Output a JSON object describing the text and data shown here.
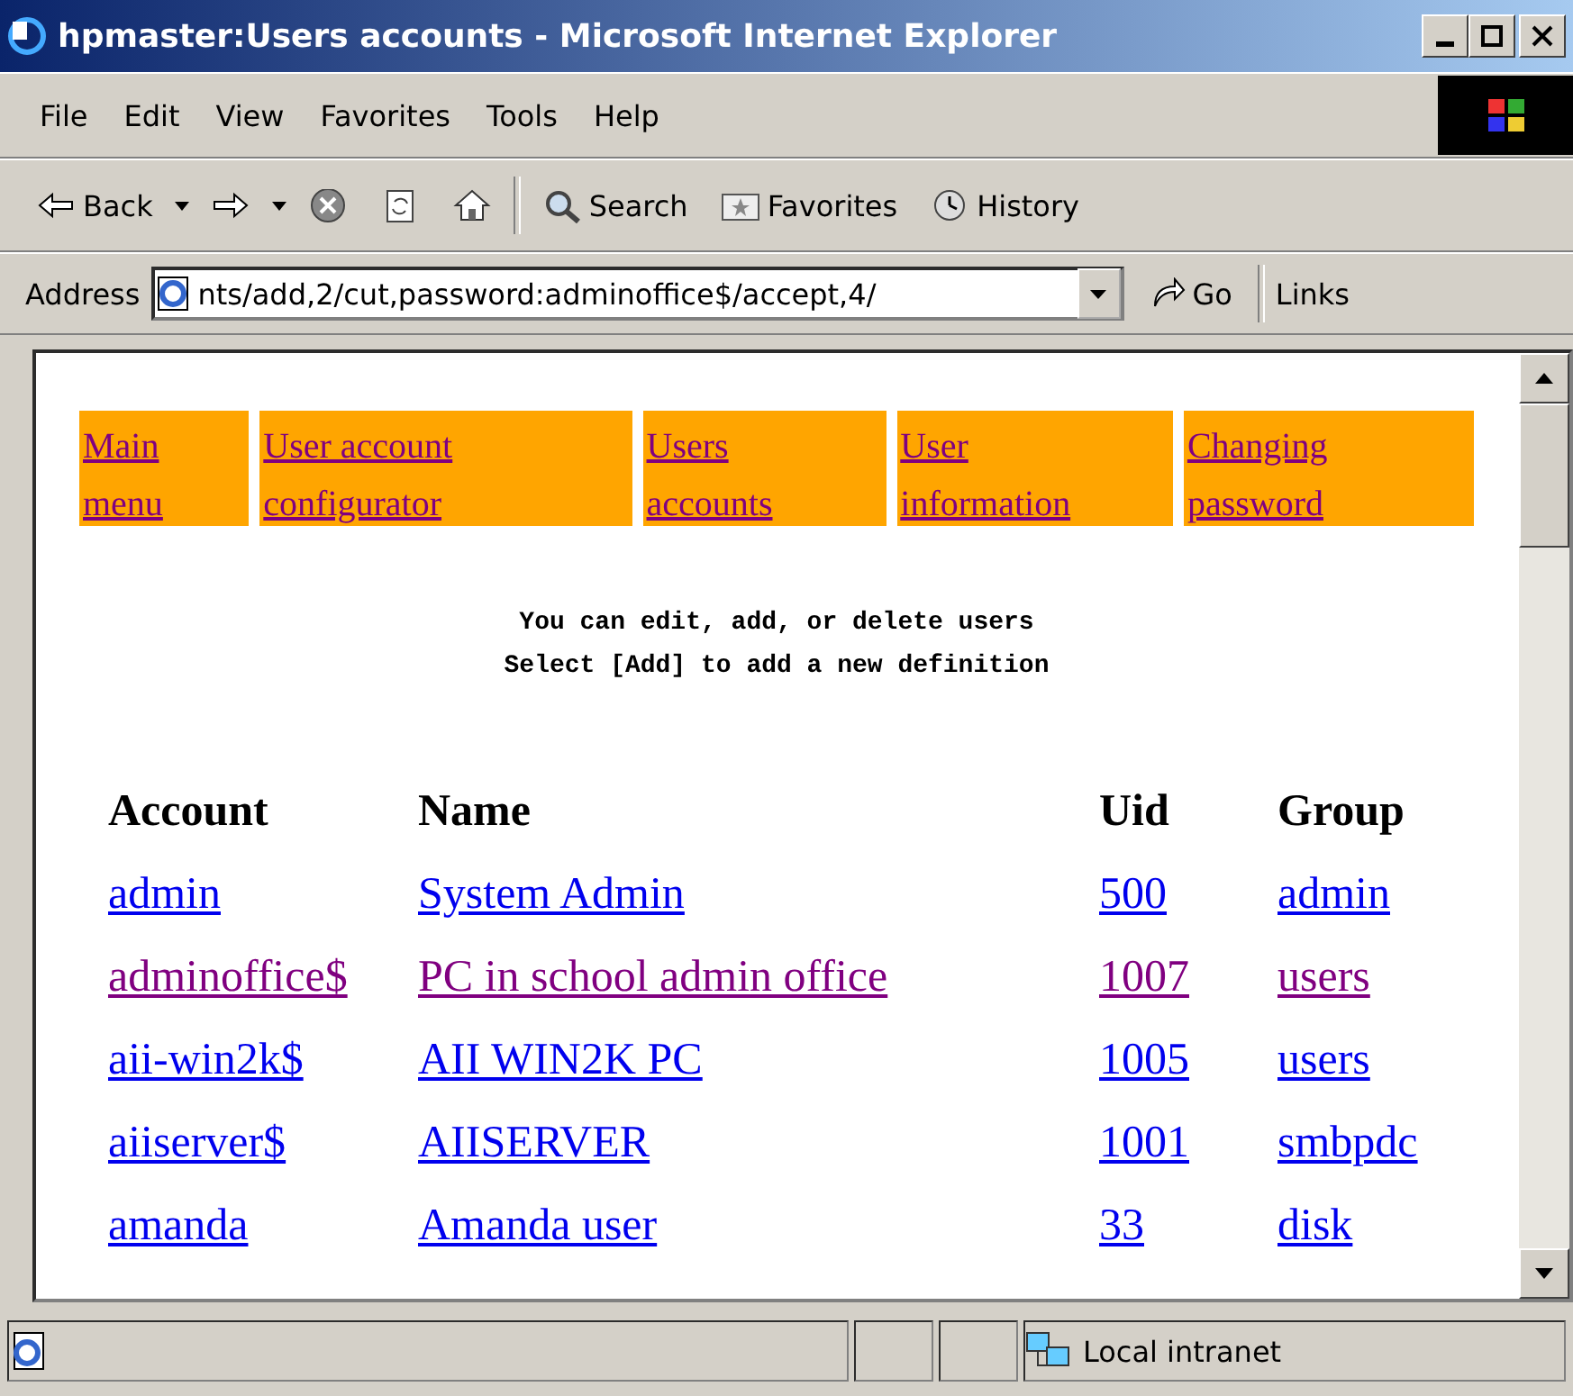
{
  "window": {
    "title": "hpmaster:Users accounts - Microsoft Internet Explorer"
  },
  "menu": [
    "File",
    "Edit",
    "View",
    "Favorites",
    "Tools",
    "Help"
  ],
  "toolbar": [
    {
      "kind": "back",
      "label": "Back"
    },
    {
      "kind": "forward"
    },
    {
      "kind": "stop"
    },
    {
      "kind": "refresh"
    },
    {
      "kind": "home"
    },
    {
      "kind": "search",
      "label": "Search"
    },
    {
      "kind": "favorites",
      "label": "Favorites"
    },
    {
      "kind": "history",
      "label": "History"
    }
  ],
  "address": {
    "label": "Address",
    "value": "nts/add,2/cut,password:adminoffice$/accept,4/",
    "go": "Go",
    "links": "Links"
  },
  "nav": [
    {
      "label": "Main menu",
      "visited": true
    },
    {
      "label": "User account configurator",
      "visited": true
    },
    {
      "label": "Users accounts",
      "visited": true
    },
    {
      "label": "User information",
      "visited": true
    },
    {
      "label": "Changing password",
      "visited": true
    }
  ],
  "intro": [
    "You can edit, add, or delete users",
    "Select [Add] to add a new definition"
  ],
  "table": {
    "columns": [
      "Account",
      "Name",
      "Uid",
      "Group"
    ],
    "rows": [
      {
        "cells": [
          "admin",
          "System Admin",
          "500",
          "admin"
        ],
        "visited": false
      },
      {
        "cells": [
          "adminoffice$",
          "PC in school admin office",
          "1007",
          "users"
        ],
        "visited": true
      },
      {
        "cells": [
          "aii-win2k$",
          "AII WIN2K PC",
          "1005",
          "users"
        ],
        "visited": false
      },
      {
        "cells": [
          "aiiserver$",
          "AIISERVER",
          "1001",
          "smbpdc"
        ],
        "visited": false
      },
      {
        "cells": [
          "amanda",
          "Amanda user",
          "33",
          "disk"
        ],
        "visited": false
      }
    ]
  },
  "status_bar": {
    "zone": "Local intranet"
  }
}
